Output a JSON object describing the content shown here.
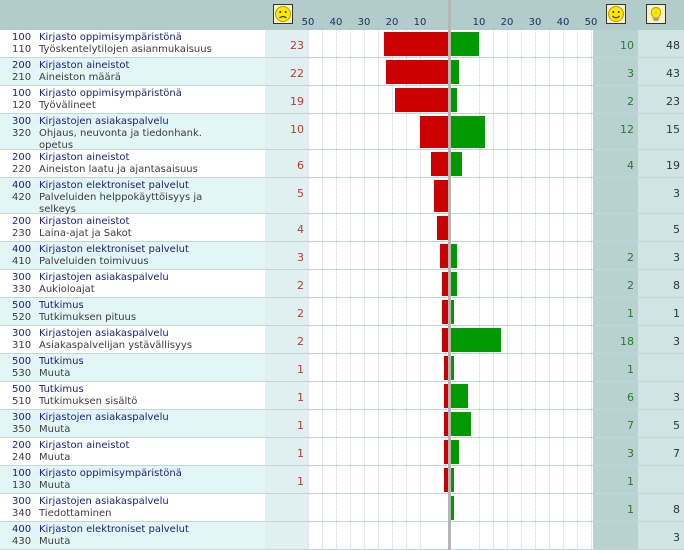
{
  "chart_data": {
    "type": "bar",
    "scale": {
      "ticks_left": [
        "50",
        "40",
        "30",
        "20",
        "10"
      ],
      "ticks_right": [
        "10",
        "20",
        "30",
        "40",
        "50"
      ],
      "max": 50
    },
    "header_icons": [
      "sad-face-icon",
      "happy-face-icon",
      "lightbulb-icon"
    ],
    "colors": {
      "negative": "#cc0000",
      "positive": "#009900",
      "header": "#b2cccc"
    },
    "rows": [
      {
        "l1_code": "100",
        "l1_text": "Kirjasto oppimisympäristönä",
        "l2_code": "110",
        "l2_text": "Työskentelytilojen asianmukaisuus",
        "l3": "",
        "neg": 23,
        "pos": 10,
        "ideas": "48"
      },
      {
        "l1_code": "200",
        "l1_text": "Kirjaston aineistot",
        "l2_code": "210",
        "l2_text": "Aineiston määrä",
        "l3": "",
        "neg": 22,
        "pos": 3,
        "ideas": "43"
      },
      {
        "l1_code": "100",
        "l1_text": "Kirjasto oppimisympäristönä",
        "l2_code": "120",
        "l2_text": "Työvälineet",
        "l3": "",
        "neg": 19,
        "pos": 2,
        "ideas": "23"
      },
      {
        "l1_code": "300",
        "l1_text": "Kirjastojen asiakaspalvelu",
        "l2_code": "320",
        "l2_text": "Ohjaus, neuvonta ja tiedonhank.",
        "l3": "opetus",
        "neg": 10,
        "pos": 12,
        "ideas": "15"
      },
      {
        "l1_code": "200",
        "l1_text": "Kirjaston aineistot",
        "l2_code": "220",
        "l2_text": "Aineiston laatu ja ajantasaisuus",
        "l3": "",
        "neg": 6,
        "pos": 4,
        "ideas": "19"
      },
      {
        "l1_code": "400",
        "l1_text": "Kirjaston elektroniset palvelut",
        "l2_code": "420",
        "l2_text": "Palveluiden helppokäyttöisyys ja",
        "l3": "selkeys",
        "neg": 5,
        "pos": 0,
        "ideas": "3"
      },
      {
        "l1_code": "200",
        "l1_text": "Kirjaston aineistot",
        "l2_code": "230",
        "l2_text": "Laina-ajat ja Sakot",
        "l3": "",
        "neg": 4,
        "pos": 0,
        "ideas": "5"
      },
      {
        "l1_code": "400",
        "l1_text": "Kirjaston elektroniset palvelut",
        "l2_code": "410",
        "l2_text": "Palveluiden toimivuus",
        "l3": "",
        "neg": 3,
        "pos": 2,
        "ideas": "3"
      },
      {
        "l1_code": "300",
        "l1_text": "Kirjastojen asiakaspalvelu",
        "l2_code": "330",
        "l2_text": "Aukioloajat",
        "l3": "",
        "neg": 2,
        "pos": 2,
        "ideas": "8"
      },
      {
        "l1_code": "500",
        "l1_text": "Tutkimus",
        "l2_code": "520",
        "l2_text": "Tutkimuksen pituus",
        "l3": "",
        "neg": 2,
        "pos": 1,
        "ideas": "1"
      },
      {
        "l1_code": "300",
        "l1_text": "Kirjastojen asiakaspalvelu",
        "l2_code": "310",
        "l2_text": "Asiakaspalvelijan ystävällisyys",
        "l3": "",
        "neg": 2,
        "pos": 18,
        "ideas": "3"
      },
      {
        "l1_code": "500",
        "l1_text": "Tutkimus",
        "l2_code": "530",
        "l2_text": "Muuta",
        "l3": "",
        "neg": 1,
        "pos": 1,
        "ideas": ""
      },
      {
        "l1_code": "500",
        "l1_text": "Tutkimus",
        "l2_code": "510",
        "l2_text": "Tutkimuksen sisältö",
        "l3": "",
        "neg": 1,
        "pos": 6,
        "ideas": "3"
      },
      {
        "l1_code": "300",
        "l1_text": "Kirjastojen asiakaspalvelu",
        "l2_code": "350",
        "l2_text": "Muuta",
        "l3": "",
        "neg": 1,
        "pos": 7,
        "ideas": "5"
      },
      {
        "l1_code": "200",
        "l1_text": "Kirjaston aineistot",
        "l2_code": "240",
        "l2_text": "Muuta",
        "l3": "",
        "neg": 1,
        "pos": 3,
        "ideas": "7"
      },
      {
        "l1_code": "100",
        "l1_text": "Kirjasto oppimisympäristönä",
        "l2_code": "130",
        "l2_text": "Muuta",
        "l3": "",
        "neg": 1,
        "pos": 1,
        "ideas": ""
      },
      {
        "l1_code": "300",
        "l1_text": "Kirjastojen asiakaspalvelu",
        "l2_code": "340",
        "l2_text": "Tiedottaminen",
        "l3": "",
        "neg": 0,
        "pos": 1,
        "ideas": "8"
      },
      {
        "l1_code": "400",
        "l1_text": "Kirjaston elektroniset palvelut",
        "l2_code": "430",
        "l2_text": "Muuta",
        "l3": "",
        "neg": 0,
        "pos": 0,
        "ideas": "3"
      }
    ]
  }
}
